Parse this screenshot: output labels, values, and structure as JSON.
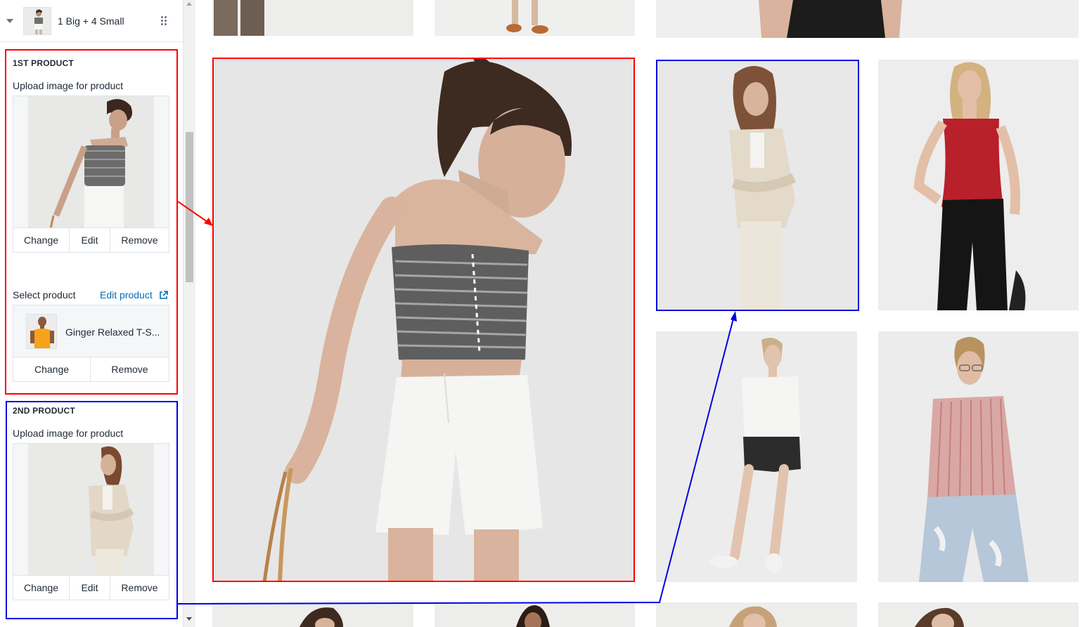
{
  "block": {
    "title": "1 Big + 4 Small",
    "thumb_icon": "product-grid-thumbnail"
  },
  "product1": {
    "heading": "1ST PRODUCT",
    "upload_label": "Upload image for product",
    "image_buttons": {
      "change": "Change",
      "edit": "Edit",
      "remove": "Remove"
    },
    "select_label": "Select product",
    "edit_product_link": "Edit product",
    "selected_product": "Ginger Relaxed T-S...",
    "product_buttons": {
      "change": "Change",
      "remove": "Remove"
    }
  },
  "product2": {
    "heading": "2ND PRODUCT",
    "upload_label": "Upload image for product",
    "image_buttons": {
      "change": "Change",
      "edit": "Edit",
      "remove": "Remove"
    }
  },
  "colors": {
    "highlight_first": "#ff0000",
    "highlight_second": "#0000e6",
    "link": "#006fbb",
    "sidebar_border": "#dfe3e8"
  },
  "icons": [
    "caret-down-icon",
    "drag-handle-icon",
    "external-link-icon",
    "scroll-up-icon",
    "scroll-down-icon"
  ]
}
